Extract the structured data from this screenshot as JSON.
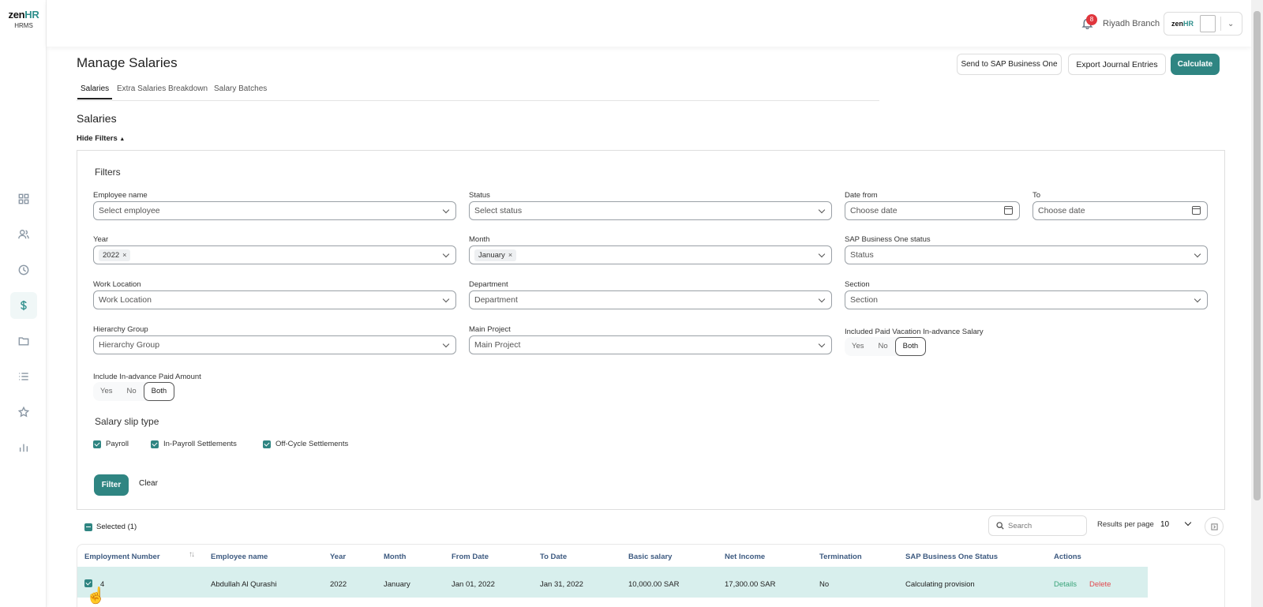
{
  "app": {
    "logo_word": "zen",
    "logo_accent": "HR",
    "logo_sub": "HRMS",
    "accent_color": "#2f8582"
  },
  "sidebar": {
    "items": [
      {
        "icon": "dashboard-icon"
      },
      {
        "icon": "people-icon"
      },
      {
        "icon": "clock-icon"
      },
      {
        "icon": "dollar-icon",
        "active": true
      },
      {
        "icon": "folder-icon"
      },
      {
        "icon": "list-icon"
      },
      {
        "icon": "star-icon"
      },
      {
        "icon": "bar-chart-icon"
      }
    ]
  },
  "topbar": {
    "notifications_count": "8",
    "branch": "Riyadh Branch",
    "account_logo_word": "zen",
    "account_logo_accent": "HR"
  },
  "header": {
    "title": "Manage Salaries",
    "send_sap_label": "Send to SAP Business One",
    "export_label": "Export Journal Entries",
    "calculate_label": "Calculate"
  },
  "tabs": [
    {
      "label": "Salaries",
      "active": true
    },
    {
      "label": "Extra Salaries Breakdown"
    },
    {
      "label": "Salary Batches"
    }
  ],
  "section_title": "Salaries",
  "hide_filters_label": "Hide Filters",
  "filters": {
    "heading": "Filters",
    "employee_name": {
      "label": "Employee name",
      "placeholder": "Select employee"
    },
    "status": {
      "label": "Status",
      "placeholder": "Select status"
    },
    "date_from": {
      "label": "Date from",
      "placeholder": "Choose date"
    },
    "date_to": {
      "label": "To",
      "placeholder": "Choose date"
    },
    "year": {
      "label": "Year",
      "selected": "2022"
    },
    "month": {
      "label": "Month",
      "selected": "January"
    },
    "sap_status": {
      "label": "SAP Business One status",
      "placeholder": "Status"
    },
    "work_location": {
      "label": "Work Location",
      "placeholder": "Work Location"
    },
    "department": {
      "label": "Department",
      "placeholder": "Department"
    },
    "section": {
      "label": "Section",
      "placeholder": "Section"
    },
    "hierarchy_group": {
      "label": "Hierarchy Group",
      "placeholder": "Hierarchy Group"
    },
    "main_project": {
      "label": "Main Project",
      "placeholder": "Main Project"
    },
    "paid_vacation": {
      "label": "Included Paid Vacation In-advance Salary",
      "options": [
        "Yes",
        "No",
        "Both"
      ],
      "selected": "Both"
    },
    "inadvance_paid": {
      "label": "Include In-advance Paid Amount",
      "options": [
        "Yes",
        "No",
        "Both"
      ],
      "selected": "Both"
    },
    "slip_type": {
      "title": "Salary slip type",
      "options": [
        {
          "label": "Payroll",
          "checked": true
        },
        {
          "label": "In-Payroll Settlements",
          "checked": true
        },
        {
          "label": "Off-Cycle Settlements",
          "checked": true
        }
      ]
    },
    "filter_label": "Filter",
    "clear_label": "Clear"
  },
  "table": {
    "selected_label": "Selected (1)",
    "search_placeholder": "Search",
    "results_per_page_label": "Results per page",
    "results_per_page": "10",
    "columns": [
      "Employment Number",
      "Employee name",
      "Year",
      "Month",
      "From Date",
      "To Date",
      "Basic salary",
      "Net Income",
      "Termination",
      "SAP Business One Status",
      "Actions"
    ],
    "rows": [
      {
        "employment_number": "4",
        "employee_name": "Abdullah Al Qurashi",
        "year": "2022",
        "month": "January",
        "from_date": "Jan 01, 2022",
        "to_date": "Jan 31, 2022",
        "basic_salary": "10,000.00 SAR",
        "net_income": "17,300.00 SAR",
        "termination": "No",
        "sap_status": "Calculating provision",
        "details_label": "Details",
        "delete_label": "Delete",
        "selected": true
      }
    ]
  }
}
